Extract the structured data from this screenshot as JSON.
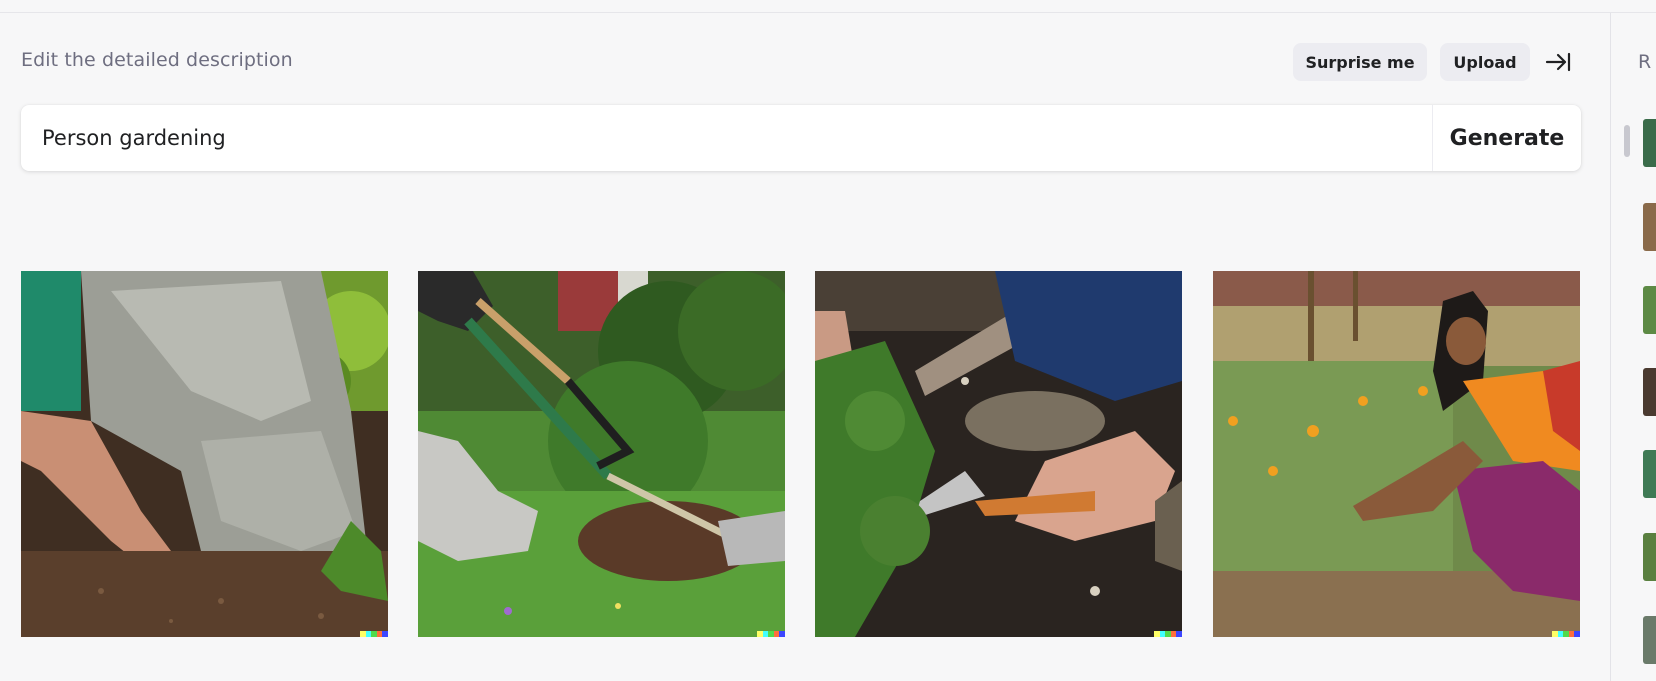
{
  "editor": {
    "heading": "Edit the detailed description",
    "surprise_label": "Surprise me",
    "upload_label": "Upload",
    "collapse_icon": "arrow-right-to-bar-icon"
  },
  "prompt": {
    "value": "Person gardening",
    "generate_label": "Generate"
  },
  "results": [
    {
      "alt": "Gloved hands and gray bag over soil"
    },
    {
      "alt": "Boot and garden rake beside shrub"
    },
    {
      "alt": "Hands with pruning shears cutting plant"
    },
    {
      "alt": "Woman tending marigold garden"
    }
  ],
  "signature_colors": [
    "#ffff66",
    "#42ffff",
    "#51da4c",
    "#ff6e3c",
    "#3c46ff"
  ],
  "sidebar": {
    "heading_initial": "R",
    "thumb_colors": [
      "#3a6b4a",
      "#8a6a4a",
      "#5d8a45",
      "#4a3a30",
      "#3f7a55",
      "#5a8040",
      "#6a7a6a"
    ]
  }
}
